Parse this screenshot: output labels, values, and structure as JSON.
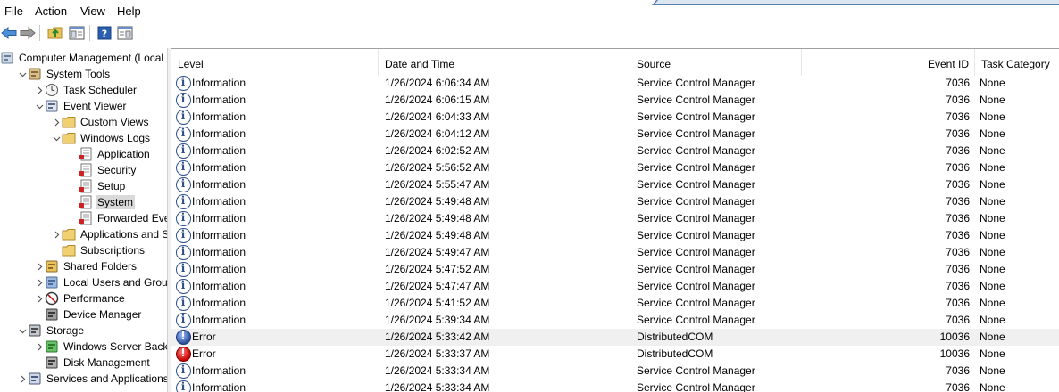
{
  "menu": [
    "File",
    "Action",
    "View",
    "Help"
  ],
  "toolbar": {
    "icons": [
      "back-arrow-icon",
      "forward-arrow-icon",
      "up-folder-icon",
      "show-hide-console-tree-icon",
      "help-icon",
      "show-hide-action-pane-icon"
    ]
  },
  "tree": [
    {
      "label": "Computer Management (Local",
      "icon": "computer-management-icon",
      "expander": "",
      "level": 0
    },
    {
      "label": "System Tools",
      "icon": "system-tools-icon",
      "expander": "down",
      "level": 1
    },
    {
      "label": "Task Scheduler",
      "icon": "clock-icon",
      "expander": "right",
      "level": 2
    },
    {
      "label": "Event Viewer",
      "icon": "event-viewer-icon",
      "expander": "down",
      "level": 2
    },
    {
      "label": "Custom Views",
      "icon": "folder-icon",
      "expander": "right",
      "level": 3
    },
    {
      "label": "Windows Logs",
      "icon": "folder-icon",
      "expander": "down",
      "level": 3
    },
    {
      "label": "Application",
      "icon": "log-icon",
      "expander": "",
      "level": 4
    },
    {
      "label": "Security",
      "icon": "log-icon",
      "expander": "",
      "level": 4
    },
    {
      "label": "Setup",
      "icon": "log-icon",
      "expander": "",
      "level": 4
    },
    {
      "label": "System",
      "icon": "log-icon",
      "expander": "",
      "level": 4,
      "selected": true
    },
    {
      "label": "Forwarded Event",
      "icon": "log-icon",
      "expander": "",
      "level": 4
    },
    {
      "label": "Applications and Se",
      "icon": "folder-icon",
      "expander": "right",
      "level": 3
    },
    {
      "label": "Subscriptions",
      "icon": "subscriptions-icon",
      "expander": "",
      "level": 3
    },
    {
      "label": "Shared Folders",
      "icon": "shared-folders-icon",
      "expander": "right",
      "level": 2
    },
    {
      "label": "Local Users and Groups",
      "icon": "users-icon",
      "expander": "right",
      "level": 2
    },
    {
      "label": "Performance",
      "icon": "performance-icon",
      "expander": "right",
      "level": 2
    },
    {
      "label": "Device Manager",
      "icon": "device-manager-icon",
      "expander": "",
      "level": 2
    },
    {
      "label": "Storage",
      "icon": "storage-icon",
      "expander": "down",
      "level": 1
    },
    {
      "label": "Windows Server Backup",
      "icon": "backup-icon",
      "expander": "right",
      "level": 2
    },
    {
      "label": "Disk Management",
      "icon": "disk-icon",
      "expander": "",
      "level": 2
    },
    {
      "label": "Services and Applications",
      "icon": "services-icon",
      "expander": "right",
      "level": 1
    }
  ],
  "columns": {
    "level": "Level",
    "date": "Date and Time",
    "source": "Source",
    "event_id": "Event ID",
    "task": "Task Category"
  },
  "events": [
    {
      "level": "Information",
      "date": "1/26/2024 6:06:34 AM",
      "source": "Service Control Manager",
      "id": "7036",
      "task": "None"
    },
    {
      "level": "Information",
      "date": "1/26/2024 6:06:15 AM",
      "source": "Service Control Manager",
      "id": "7036",
      "task": "None"
    },
    {
      "level": "Information",
      "date": "1/26/2024 6:04:33 AM",
      "source": "Service Control Manager",
      "id": "7036",
      "task": "None"
    },
    {
      "level": "Information",
      "date": "1/26/2024 6:04:12 AM",
      "source": "Service Control Manager",
      "id": "7036",
      "task": "None"
    },
    {
      "level": "Information",
      "date": "1/26/2024 6:02:52 AM",
      "source": "Service Control Manager",
      "id": "7036",
      "task": "None"
    },
    {
      "level": "Information",
      "date": "1/26/2024 5:56:52 AM",
      "source": "Service Control Manager",
      "id": "7036",
      "task": "None"
    },
    {
      "level": "Information",
      "date": "1/26/2024 5:55:47 AM",
      "source": "Service Control Manager",
      "id": "7036",
      "task": "None"
    },
    {
      "level": "Information",
      "date": "1/26/2024 5:49:48 AM",
      "source": "Service Control Manager",
      "id": "7036",
      "task": "None"
    },
    {
      "level": "Information",
      "date": "1/26/2024 5:49:48 AM",
      "source": "Service Control Manager",
      "id": "7036",
      "task": "None"
    },
    {
      "level": "Information",
      "date": "1/26/2024 5:49:48 AM",
      "source": "Service Control Manager",
      "id": "7036",
      "task": "None"
    },
    {
      "level": "Information",
      "date": "1/26/2024 5:49:47 AM",
      "source": "Service Control Manager",
      "id": "7036",
      "task": "None"
    },
    {
      "level": "Information",
      "date": "1/26/2024 5:47:52 AM",
      "source": "Service Control Manager",
      "id": "7036",
      "task": "None"
    },
    {
      "level": "Information",
      "date": "1/26/2024 5:47:47 AM",
      "source": "Service Control Manager",
      "id": "7036",
      "task": "None"
    },
    {
      "level": "Information",
      "date": "1/26/2024 5:41:52 AM",
      "source": "Service Control Manager",
      "id": "7036",
      "task": "None"
    },
    {
      "level": "Information",
      "date": "1/26/2024 5:39:34 AM",
      "source": "Service Control Manager",
      "id": "7036",
      "task": "None"
    },
    {
      "level": "Error",
      "date": "1/26/2024 5:33:42 AM",
      "source": "DistributedCOM",
      "id": "10036",
      "task": "None",
      "highlight": true,
      "icon": "error-alt"
    },
    {
      "level": "Error",
      "date": "1/26/2024 5:33:37 AM",
      "source": "DistributedCOM",
      "id": "10036",
      "task": "None"
    },
    {
      "level": "Information",
      "date": "1/26/2024 5:33:34 AM",
      "source": "Service Control Manager",
      "id": "7036",
      "task": "None"
    },
    {
      "level": "Information",
      "date": "1/26/2024 5:33:34 AM",
      "source": "Service Control Manager",
      "id": "7036",
      "task": "None"
    }
  ]
}
